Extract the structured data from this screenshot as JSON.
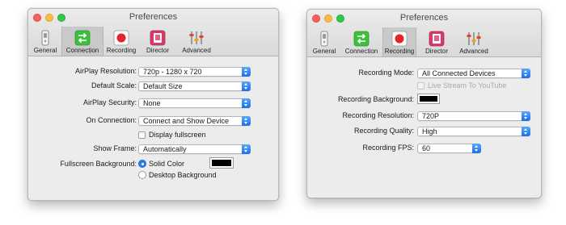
{
  "windows": [
    {
      "title": "Preferences",
      "tabs": [
        {
          "label": "General",
          "icon": "switch-icon",
          "selected": false
        },
        {
          "label": "Connection",
          "icon": "connection-arrows-icon",
          "selected": true
        },
        {
          "label": "Recording",
          "icon": "record-icon",
          "selected": false
        },
        {
          "label": "Director",
          "icon": "director-icon",
          "selected": false
        },
        {
          "label": "Advanced",
          "icon": "sliders-icon",
          "selected": false
        }
      ],
      "fields": {
        "airplay_resolution": {
          "label": "AirPlay Resolution:",
          "value": "720p - 1280 x 720"
        },
        "default_scale": {
          "label": "Default Scale:",
          "value": "Default Size"
        },
        "airplay_security": {
          "label": "AirPlay Security:",
          "value": "None"
        },
        "on_connection": {
          "label": "On Connection:",
          "value": "Connect and Show Device"
        },
        "display_fullscreen": {
          "label": "Display fullscreen",
          "checked": false
        },
        "show_frame": {
          "label": "Show Frame:",
          "value": "Automatically"
        },
        "fullscreen_background": {
          "label": "Fullscreen Background:",
          "options": [
            "Solid Color",
            "Desktop Background"
          ],
          "selected": "Solid Color",
          "color": "#000000"
        }
      }
    },
    {
      "title": "Preferences",
      "tabs": [
        {
          "label": "General",
          "icon": "switch-icon",
          "selected": false
        },
        {
          "label": "Connection",
          "icon": "connection-arrows-icon",
          "selected": false
        },
        {
          "label": "Recording",
          "icon": "record-icon",
          "selected": true
        },
        {
          "label": "Director",
          "icon": "director-icon",
          "selected": false
        },
        {
          "label": "Advanced",
          "icon": "sliders-icon",
          "selected": false
        }
      ],
      "fields": {
        "recording_mode": {
          "label": "Recording Mode:",
          "value": "All Connected Devices"
        },
        "live_stream": {
          "label": "Live Stream To YouTube",
          "checked": false,
          "enabled": false
        },
        "recording_background": {
          "label": "Recording Background:",
          "color": "#000000"
        },
        "recording_resolution": {
          "label": "Recording Resolution:",
          "value": "720P"
        },
        "recording_quality": {
          "label": "Recording Quality:",
          "value": "High"
        },
        "recording_fps": {
          "label": "Recording FPS:",
          "value": "60"
        }
      }
    }
  ],
  "colors": {
    "accent": "#2e7fe9",
    "connection_icon": "#3dbf3d",
    "record_red": "#e0262a",
    "director_pink": "#d63a6b"
  }
}
